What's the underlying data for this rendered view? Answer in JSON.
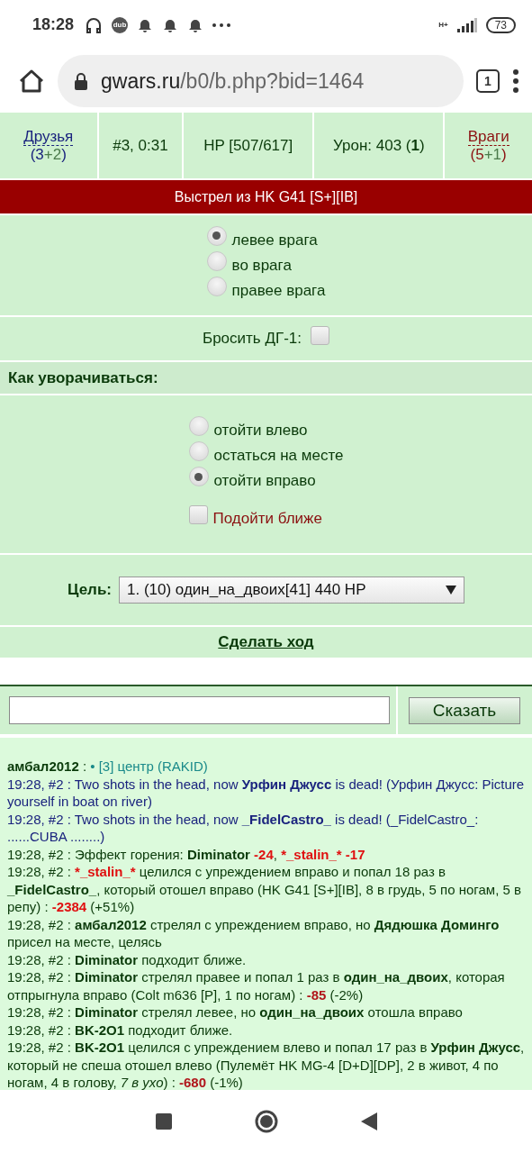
{
  "status_bar": {
    "time": "18:28",
    "badge": "dub",
    "battery": "73",
    "network": "H+"
  },
  "browser": {
    "url_host": "gwars.ru",
    "url_path": "/b0/b.php?bid=1464",
    "tab_count": "1"
  },
  "header": {
    "friends": {
      "label": "Друзья",
      "count": [
        {
          "kind": "side",
          "text": "(3"
        },
        {
          "kind": "extra",
          "text": "+2"
        },
        {
          "kind": "side",
          "text": ")"
        }
      ]
    },
    "turn": "#3, 0:31",
    "hp": "HP [507/617]",
    "damage_label": "Урон: 403 (",
    "damage_bold": "1",
    "damage_end": ")",
    "enemies": {
      "label": "Враги",
      "count": [
        {
          "kind": "side",
          "text": "(5"
        },
        {
          "kind": "extra",
          "text": "+1"
        },
        {
          "kind": "side",
          "text": ")"
        }
      ]
    }
  },
  "shot_title": "Выстрел из HK G41 [S+][IB]",
  "aim_options": [
    {
      "label": "левее врага",
      "selected": true
    },
    {
      "label": "во врага",
      "selected": false
    },
    {
      "label": "правее врага",
      "selected": false
    }
  ],
  "grenade": {
    "label": "Бросить ДГ-1:",
    "checked": false
  },
  "dodge_title": "Как уворачиваться:",
  "dodge_options": [
    {
      "label": "отойти влево",
      "selected": false
    },
    {
      "label": "остаться на месте",
      "selected": false
    },
    {
      "label": "отойти вправо",
      "selected": true
    }
  ],
  "approach": {
    "label": "Подойти ближе",
    "checked": false
  },
  "target": {
    "label": "Цель:",
    "value": "1. (10) один_на_двоих[41] 440 HP"
  },
  "make_move": "Сделать ход",
  "chat": {
    "button": "Сказать"
  },
  "log": [
    {
      "kind": "normal",
      "segments": [
        {
          "kind": "name",
          "text": "амбал2012"
        },
        {
          "kind": "plain",
          "text": " : "
        },
        {
          "kind": "info",
          "text": "• [3] центр (RAKID)"
        }
      ]
    },
    {
      "kind": "death",
      "segments": [
        {
          "kind": "plain",
          "text": "19:28, #2 : Two shots in the head, now "
        },
        {
          "kind": "name",
          "text": "Урфин Джусс"
        },
        {
          "kind": "plain",
          "text": " is dead! (Урфин Джусс: Picture yourself in boat on river)"
        }
      ]
    },
    {
      "kind": "death",
      "segments": [
        {
          "kind": "plain",
          "text": "19:28, #2 : Two shots in the head, now "
        },
        {
          "kind": "name",
          "text": "_FidelCastro_"
        },
        {
          "kind": "plain",
          "text": " is dead! (_FidelCastro_: ......CUBA ........)"
        }
      ]
    },
    {
      "kind": "normal",
      "segments": [
        {
          "kind": "plain",
          "text": "19:28, #2 : Эффект горения: "
        },
        {
          "kind": "name",
          "text": "Diminator"
        },
        {
          "kind": "dmg",
          "text": " -24"
        },
        {
          "kind": "plain",
          "text": ", "
        },
        {
          "kind": "dmg",
          "text": "*_stalin_* -17"
        }
      ]
    },
    {
      "kind": "normal",
      "segments": [
        {
          "kind": "plain",
          "text": "19:28, #2 : "
        },
        {
          "kind": "dmg",
          "text": "*_stalin_*"
        },
        {
          "kind": "plain",
          "text": " целился с упреждением вправо и попал 18 раз в "
        },
        {
          "kind": "name",
          "text": "_FidelCastro_"
        },
        {
          "kind": "plain",
          "text": ", который отошел вправо (HK G41 [S+][IB], 8 в грудь, 5 по ногам, 5 в репу) : "
        },
        {
          "kind": "dmg",
          "text": "-2384"
        },
        {
          "kind": "plain",
          "text": " (+51%)"
        }
      ]
    },
    {
      "kind": "normal",
      "segments": [
        {
          "kind": "plain",
          "text": "19:28, #2 : "
        },
        {
          "kind": "name",
          "text": "амбал2012"
        },
        {
          "kind": "plain",
          "text": " стрелял с упреждением вправо, но "
        },
        {
          "kind": "name",
          "text": "Дядюшка Доминго"
        },
        {
          "kind": "plain",
          "text": " присел на месте, целясь"
        }
      ]
    },
    {
      "kind": "normal",
      "segments": [
        {
          "kind": "plain",
          "text": "19:28, #2 : "
        },
        {
          "kind": "name",
          "text": "Diminator"
        },
        {
          "kind": "plain",
          "text": " подходит ближе."
        }
      ]
    },
    {
      "kind": "normal",
      "segments": [
        {
          "kind": "plain",
          "text": "19:28, #2 : "
        },
        {
          "kind": "name",
          "text": "Diminator"
        },
        {
          "kind": "plain",
          "text": " стрелял правее и попал 1 раз в "
        },
        {
          "kind": "name",
          "text": "один_на_двоих"
        },
        {
          "kind": "plain",
          "text": ", которая отпрыгнула вправо (Colt m636 [P], 1 по ногам) : "
        },
        {
          "kind": "dmg2",
          "text": "-85"
        },
        {
          "kind": "plain",
          "text": " (-2%)"
        }
      ]
    },
    {
      "kind": "normal",
      "segments": [
        {
          "kind": "plain",
          "text": "19:28, #2 : "
        },
        {
          "kind": "name",
          "text": "Diminator"
        },
        {
          "kind": "plain",
          "text": " стрелял левее, но "
        },
        {
          "kind": "name",
          "text": "один_на_двоих"
        },
        {
          "kind": "plain",
          "text": " отошла вправо"
        }
      ]
    },
    {
      "kind": "normal",
      "segments": [
        {
          "kind": "plain",
          "text": "19:28, #2 : "
        },
        {
          "kind": "name",
          "text": "BK-2O1"
        },
        {
          "kind": "plain",
          "text": " подходит ближе."
        }
      ]
    },
    {
      "kind": "normal",
      "segments": [
        {
          "kind": "plain",
          "text": "19:28, #2 : "
        },
        {
          "kind": "name",
          "text": "BK-2O1"
        },
        {
          "kind": "plain",
          "text": " целился с упреждением влево и попал 17 раз в "
        },
        {
          "kind": "name",
          "text": "Урфин Джусс"
        },
        {
          "kind": "plain",
          "text": ", который не спеша отошел влево (Пулемёт HK MG-4 [D+D][DP], 2 в живот, 4 по ногам, 4 в голову, "
        },
        {
          "kind": "italic",
          "text": "7 в ухо"
        },
        {
          "kind": "plain",
          "text": ") : "
        },
        {
          "kind": "dmg2",
          "text": "-680"
        },
        {
          "kind": "plain",
          "text": " (-1%)"
        }
      ]
    }
  ]
}
